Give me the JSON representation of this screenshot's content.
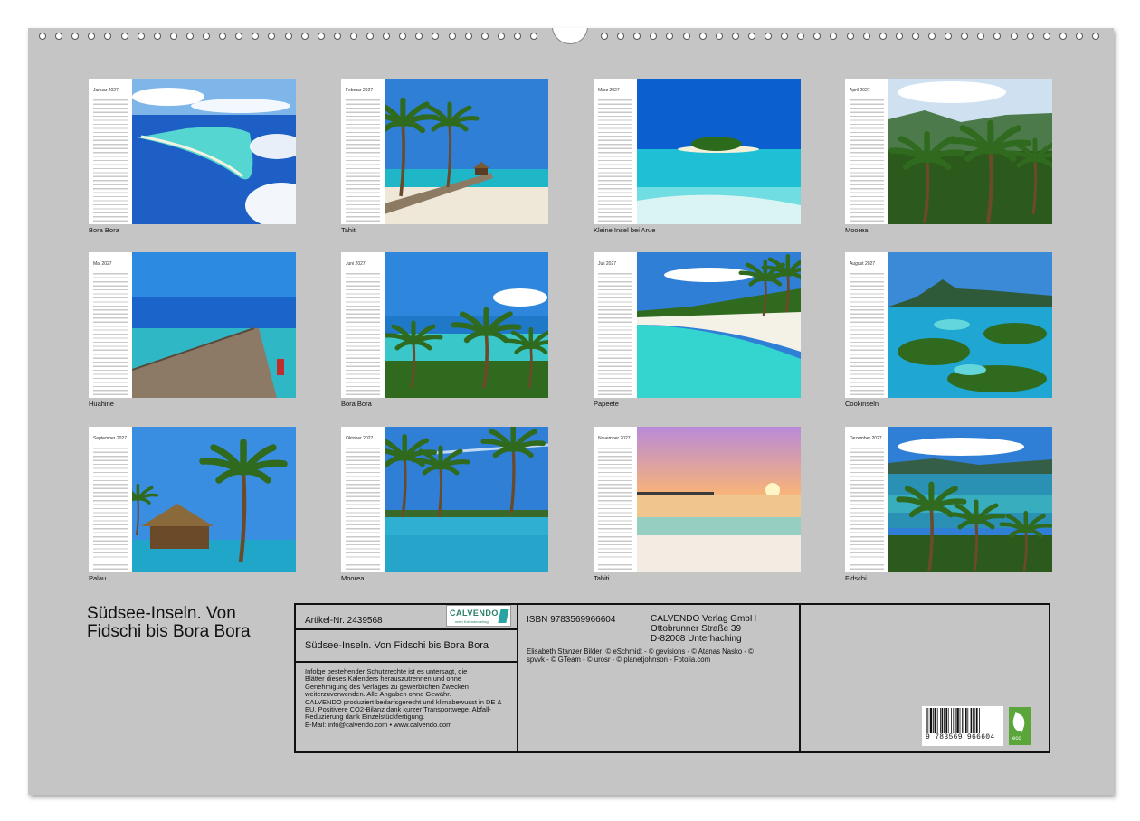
{
  "calendar": {
    "title": "Südsee-Inseln. Von Fidschi bis Bora Bora",
    "months": [
      {
        "name": "Januar 2027",
        "caption": "Bora Bora",
        "scene": "atoll"
      },
      {
        "name": "Februar 2027",
        "caption": "Tahiti",
        "scene": "jetty-palms"
      },
      {
        "name": "März 2027",
        "caption": "Kleine Insel bei Arue",
        "scene": "islet"
      },
      {
        "name": "April 2027",
        "caption": "Moorea",
        "scene": "jungle"
      },
      {
        "name": "Mai 2027",
        "caption": "Huahine",
        "scene": "pier"
      },
      {
        "name": "Juni 2027",
        "caption": "Bora Bora",
        "scene": "lagoon-palms"
      },
      {
        "name": "Juli 2027",
        "caption": "Papeete",
        "scene": "beach"
      },
      {
        "name": "August 2027",
        "caption": "Cookinseln",
        "scene": "resort"
      },
      {
        "name": "September 2027",
        "caption": "Palau",
        "scene": "hut"
      },
      {
        "name": "Oktober 2027",
        "caption": "Moorea",
        "scene": "pool"
      },
      {
        "name": "November 2027",
        "caption": "Tahiti",
        "scene": "sunset"
      },
      {
        "name": "Dezember 2027",
        "caption": "Fidschi",
        "scene": "reflection"
      }
    ]
  },
  "info": {
    "article": "Artikel-Nr. 2439568",
    "logo_name": "CALVENDO",
    "logo_tag": "mein Kalenderverlag",
    "title": "Südsee-Inseln. Von Fidschi bis Bora Bora",
    "legal": [
      "Infolge bestehender Schutzrechte ist es untersagt, die",
      "Blätter dieses Kalenders herauszutrennen und ohne",
      "Genehmigung des Verlages zu gewerblichen Zwecken",
      "weiterzuverwenden. Alle Angaben ohne Gewähr.",
      "CALVENDO produziert bedarfsgerecht und klimabewusst in DE &",
      "EU. Positivere CO2-Bilanz dank kurzer Transportwege. Abfall-",
      "Reduzierung dank Einzelstückfertigung.",
      "E-Mail: info@calvendo.com • www.calvendo.com"
    ],
    "isbn": "ISBN 9783569966604",
    "publisher": [
      "CALVENDO Verlag GmbH",
      "Ottobrunner Straße 39",
      "D-82008 Unterhaching"
    ],
    "credits": [
      "Elisabeth Stanzer Bilder: © eSchmidt - © gevisions - © Atanas Nasko - ©",
      "spvvk - © GTeam - © urosr - © planetjohnson - Fotolia.com"
    ],
    "barcode_digits": "9 783569 966604",
    "eco_label": "eco"
  },
  "colors": {
    "sheet": "#c5c5c5",
    "sea": "#1f9ec9",
    "sky": "#2d7fd6",
    "palm": "#2f6a1e",
    "sand": "#efe8d8"
  }
}
